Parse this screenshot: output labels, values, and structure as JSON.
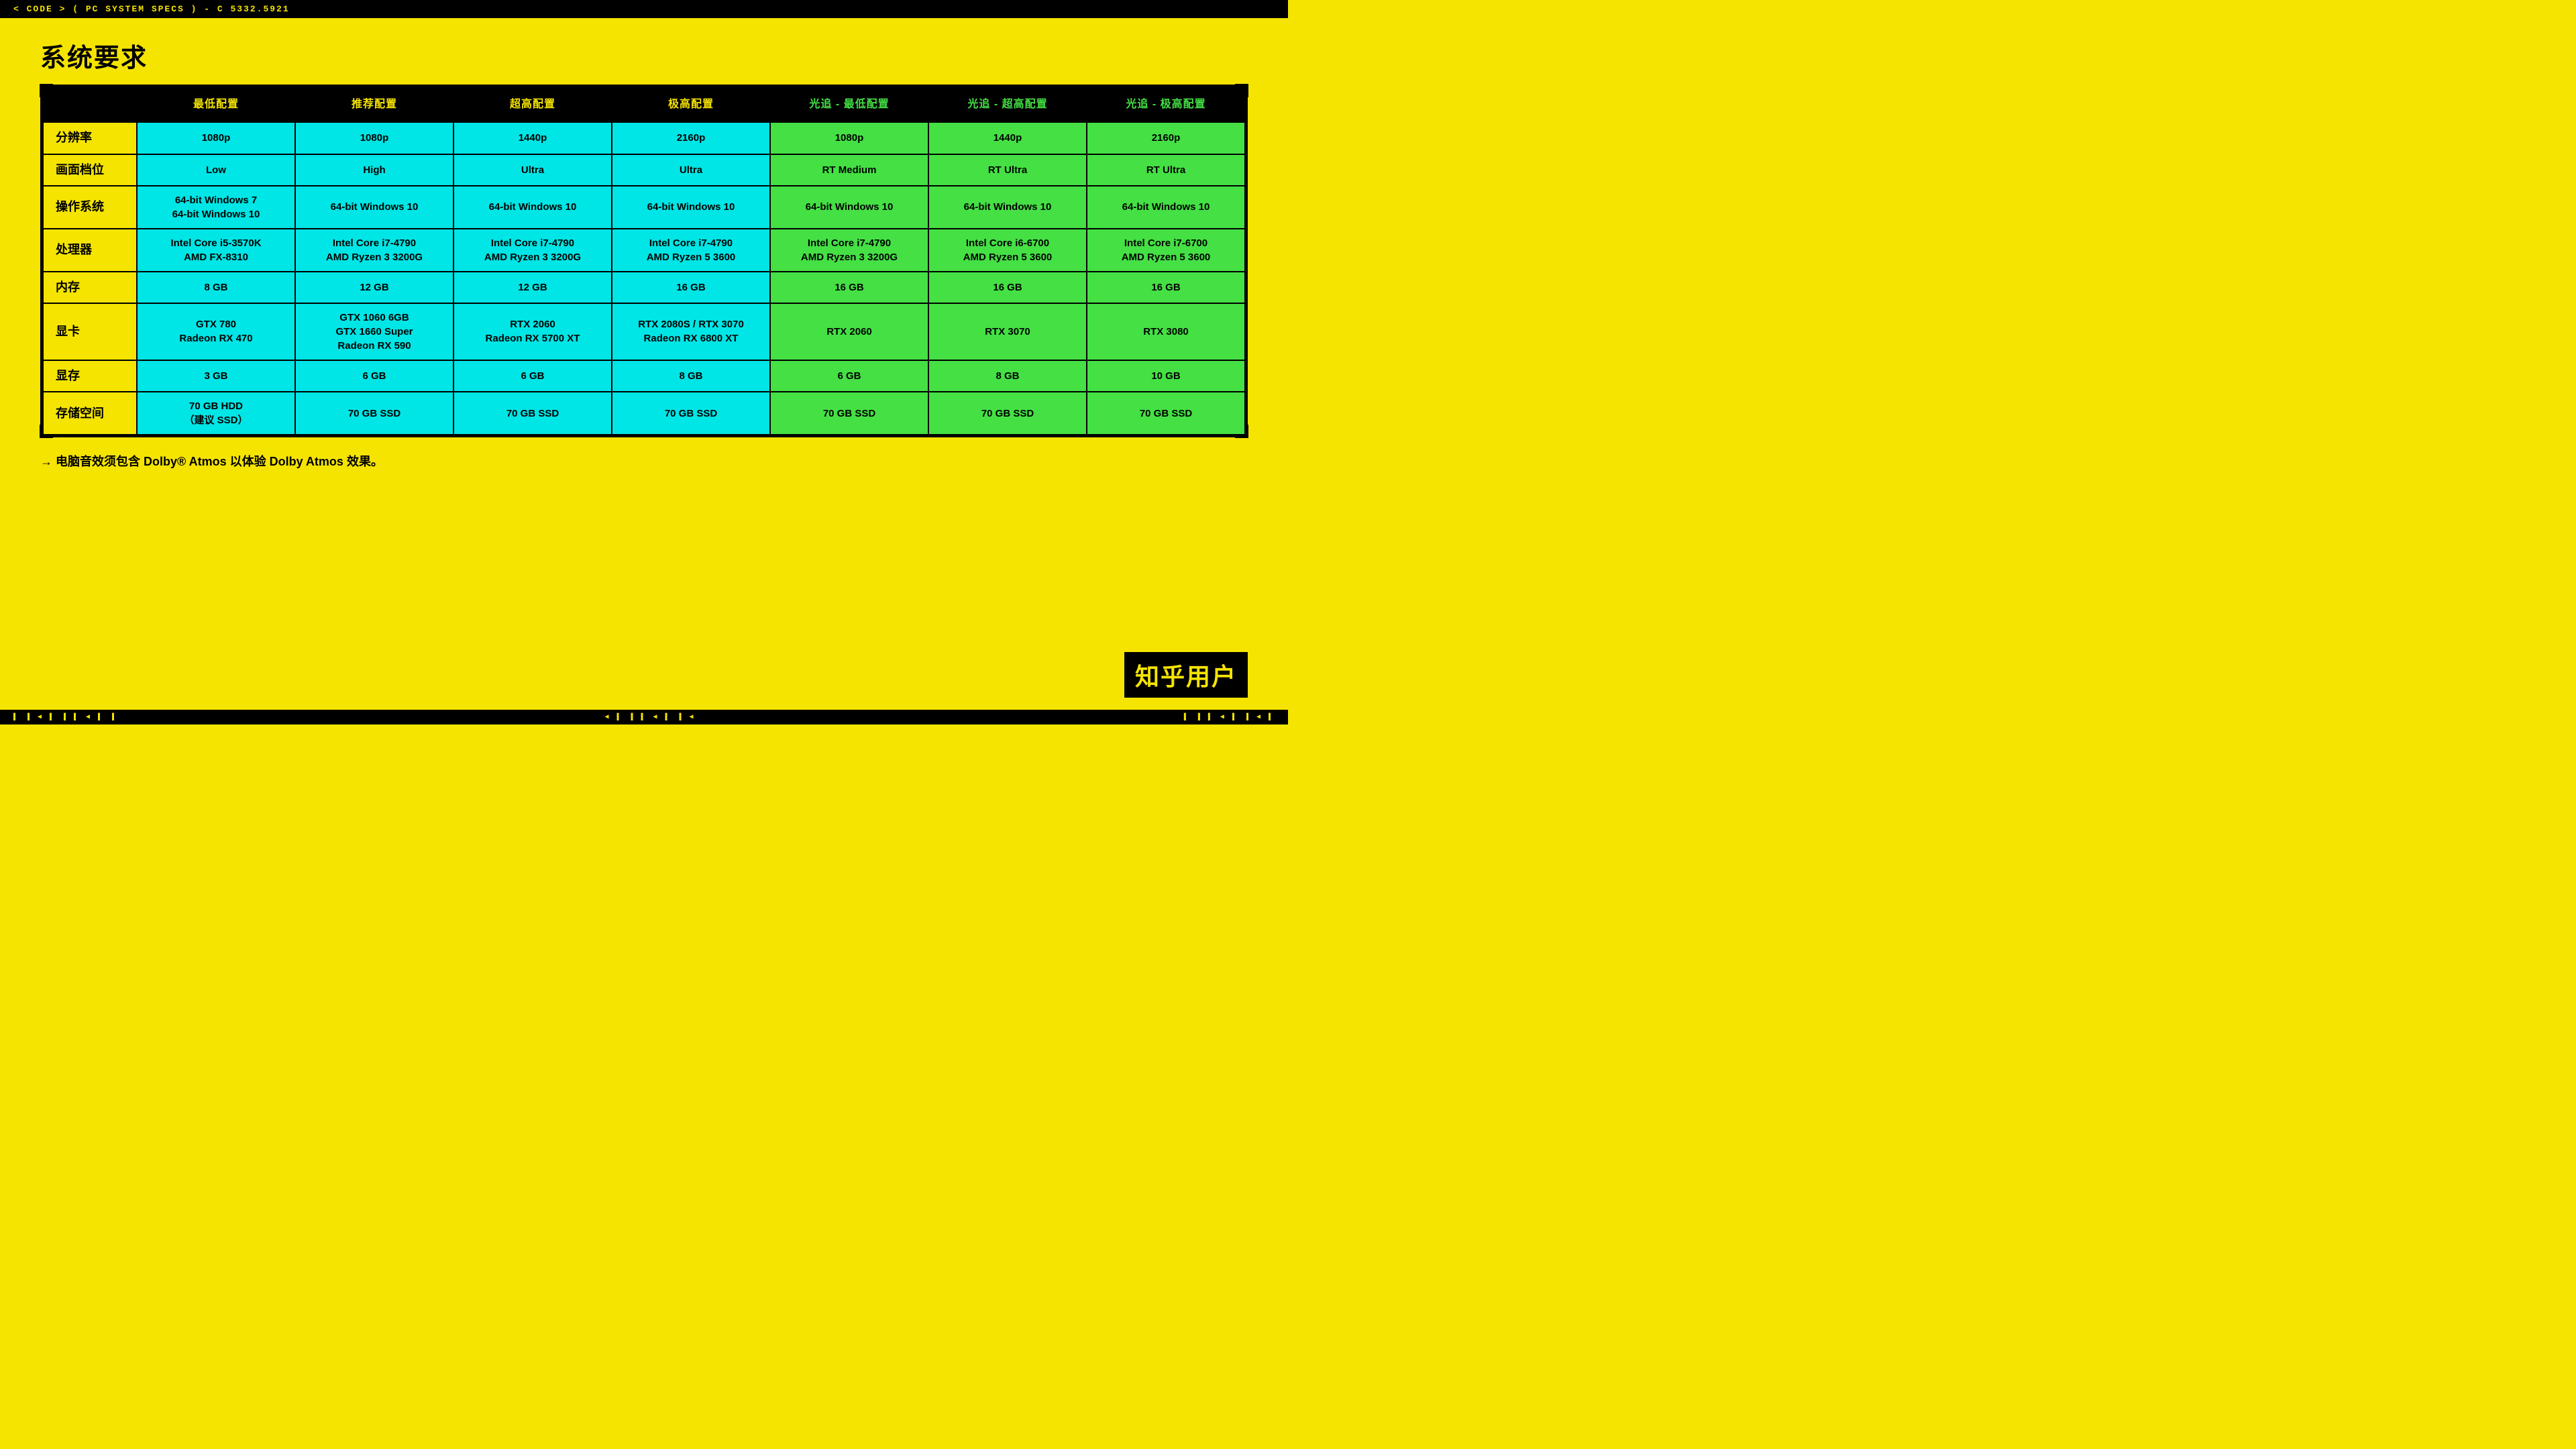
{
  "topbar": {
    "text": "< CODE > ( PC SYSTEM SPECS ) - C 5332.5921"
  },
  "page_title": "系统要求",
  "headers": {
    "label_col": "",
    "cols": [
      {
        "label": "最低配置",
        "type": "cyan"
      },
      {
        "label": "推荐配置",
        "type": "cyan"
      },
      {
        "label": "超高配置",
        "type": "cyan"
      },
      {
        "label": "极高配置",
        "type": "cyan"
      },
      {
        "label": "光追 - 最低配置",
        "type": "green"
      },
      {
        "label": "光追 - 超高配置",
        "type": "green"
      },
      {
        "label": "光追 - 极高配置",
        "type": "green"
      }
    ]
  },
  "rows": [
    {
      "label": "分辨率",
      "cells": [
        "1080p",
        "1080p",
        "1440p",
        "2160p",
        "1080p",
        "1440p",
        "2160p"
      ]
    },
    {
      "label": "画面档位",
      "cells": [
        "Low",
        "High",
        "Ultra",
        "Ultra",
        "RT Medium",
        "RT Ultra",
        "RT Ultra"
      ]
    },
    {
      "label": "操作系统",
      "cells": [
        "64-bit Windows 7\n64-bit Windows 10",
        "64-bit Windows 10",
        "64-bit Windows 10",
        "64-bit Windows 10",
        "64-bit Windows 10",
        "64-bit Windows 10",
        "64-bit Windows 10"
      ]
    },
    {
      "label": "处理器",
      "cells": [
        "Intel Core i5-3570K\nAMD FX-8310",
        "Intel Core i7-4790\nAMD Ryzen 3 3200G",
        "Intel Core i7-4790\nAMD Ryzen 3 3200G",
        "Intel Core i7-4790\nAMD Ryzen 5 3600",
        "Intel Core i7-4790\nAMD Ryzen 3 3200G",
        "Intel Core i6-6700\nAMD Ryzen 5 3600",
        "Intel Core i7-6700\nAMD Ryzen 5 3600"
      ]
    },
    {
      "label": "内存",
      "cells": [
        "8 GB",
        "12 GB",
        "12 GB",
        "16 GB",
        "16 GB",
        "16 GB",
        "16 GB"
      ]
    },
    {
      "label": "显卡",
      "cells": [
        "GTX 780\nRadeon RX 470",
        "GTX 1060 6GB\nGTX 1660 Super\nRadeon RX 590",
        "RTX 2060\nRadeon RX 5700 XT",
        "RTX 2080S / RTX 3070\nRadeon RX 6800 XT",
        "RTX 2060",
        "RTX 3070",
        "RTX 3080"
      ]
    },
    {
      "label": "显存",
      "cells": [
        "3 GB",
        "6 GB",
        "6 GB",
        "8 GB",
        "6 GB",
        "8 GB",
        "10 GB"
      ]
    },
    {
      "label": "存储空间",
      "cells": [
        "70 GB HDD\n（建议 SSD）",
        "70 GB SSD",
        "70 GB SSD",
        "70 GB SSD",
        "70 GB SSD",
        "70 GB SSD",
        "70 GB SSD"
      ]
    }
  ],
  "note": "→ 电脑音效须包含 Dolby® Atmos 以体验 Dolby Atmos 效果。",
  "watermark": "知乎用户",
  "bottom_segments": [
    "◀ ▐ ▌",
    "▐ ▌ ◀ ▌",
    "▐ ▌ ◀"
  ]
}
